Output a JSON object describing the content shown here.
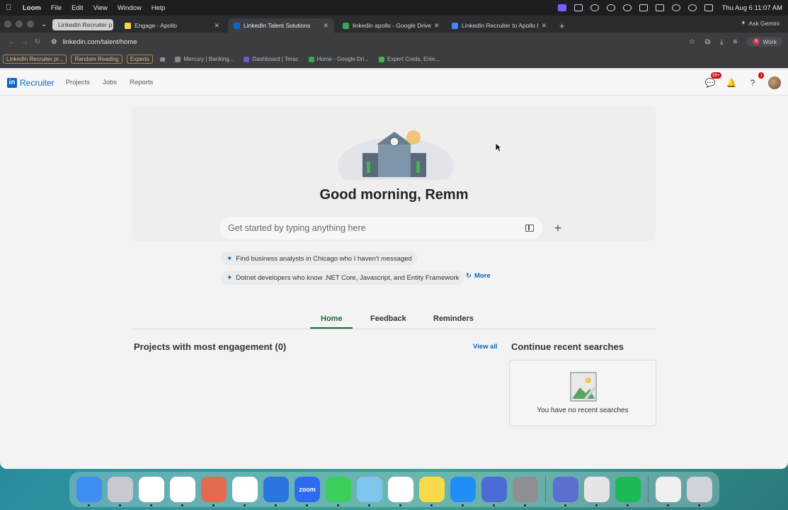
{
  "menubar": {
    "app_name": "Loom",
    "items": [
      "File",
      "Edit",
      "View",
      "Window",
      "Help"
    ],
    "clock": "Thu Aug 6  11:07 AM"
  },
  "browser": {
    "pinned_tab": "LinkedIn Recruiter p",
    "tabs": [
      {
        "title": "Engage - Apollo",
        "color": "#f2d44a"
      },
      {
        "title": "LinkedIn Talent Solutions",
        "color": "#0a66c2"
      },
      {
        "title": "linkedin apollo - Google Drive",
        "color": "#34a853"
      },
      {
        "title": "LinkedIn Recruiter to Apollo I",
        "color": "#4285f4"
      }
    ],
    "ask_gemini": "Ask Gemini",
    "url": "linkedin.com/talent/home",
    "profile_label": "Work",
    "profile_initial": "R",
    "bookmarks": [
      {
        "label": "LinkedIn Recruiter pr...",
        "boxed": true
      },
      {
        "label": "Random Reading",
        "boxed": true
      },
      {
        "label": "Experts",
        "boxed": true
      },
      {
        "label": "Mercury | Banking...",
        "boxed": false
      },
      {
        "label": "Dashboard | Terac",
        "boxed": false
      },
      {
        "label": "Home - Google Dri...",
        "boxed": false
      },
      {
        "label": "Expert Creds, Ente...",
        "boxed": false
      }
    ]
  },
  "linkedin": {
    "brand": "Recruiter",
    "logo_text": "in",
    "nav": [
      "Projects",
      "Jobs",
      "Reports"
    ],
    "messages_badge": "99+",
    "help_badge": "1",
    "greeting": "Good morning, Remm",
    "search_placeholder": "Get started by typing anything here",
    "suggestions": [
      "Find business analysts in Chicago who I haven't messaged",
      "Dotnet developers who know .NET Core, Javascript, and Entity Framework"
    ],
    "more_label": "More",
    "tabs": [
      "Home",
      "Feedback",
      "Reminders"
    ],
    "projects_title": "Projects with most engagement (0)",
    "view_all": "View all",
    "recent_title": "Continue recent searches",
    "no_recent": "You have no recent searches"
  },
  "dock": {
    "apps": [
      {
        "name": "finder",
        "color": "#3d8ef0",
        "label": ""
      },
      {
        "name": "launchpad",
        "color": "#c8c8d0",
        "label": ""
      },
      {
        "name": "chrome",
        "color": "#ffffff",
        "label": ""
      },
      {
        "name": "slack",
        "color": "#ffffff",
        "label": ""
      },
      {
        "name": "claude",
        "color": "#e26b4f",
        "label": ""
      },
      {
        "name": "chatgpt",
        "color": "#ffffff",
        "label": ""
      },
      {
        "name": "perplexity",
        "color": "#2a74e0",
        "label": ""
      },
      {
        "name": "zoom",
        "color": "#2d6cf0",
        "label": "zoom"
      },
      {
        "name": "messages",
        "color": "#3ccd5a",
        "label": ""
      },
      {
        "name": "maps",
        "color": "#7fc6ef",
        "label": ""
      },
      {
        "name": "reminders",
        "color": "#ffffff",
        "label": ""
      },
      {
        "name": "notes",
        "color": "#f7d949",
        "label": ""
      },
      {
        "name": "app-store",
        "color": "#1f8ff7",
        "label": ""
      },
      {
        "name": "iphone-mirroring",
        "color": "#4a6cd4",
        "label": ""
      },
      {
        "name": "system-settings",
        "color": "#8e8e93",
        "label": ""
      },
      {
        "name": "loom",
        "color": "#5a6fd0",
        "label": ""
      },
      {
        "name": "spreadsheet",
        "color": "#e5e5e5",
        "label": ""
      },
      {
        "name": "spotify",
        "color": "#1db954",
        "label": ""
      },
      {
        "name": "document",
        "color": "#f0f0f0",
        "label": ""
      },
      {
        "name": "trash",
        "color": "#d0d4d8",
        "label": ""
      }
    ]
  }
}
